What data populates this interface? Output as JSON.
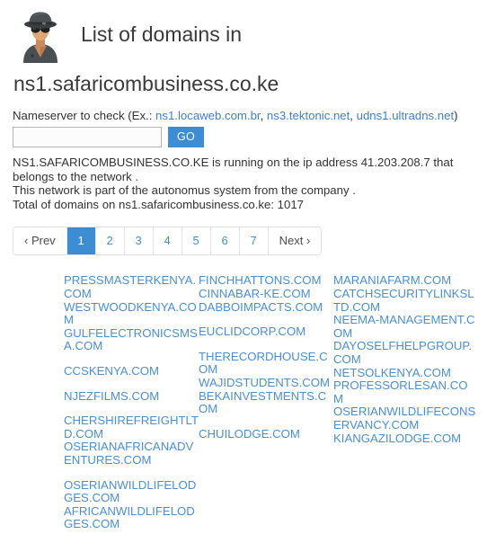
{
  "header": {
    "avatar_icon": "spy-detective-avatar-icon",
    "title_line1": "List of domains in",
    "title_line2": "ns1.safaricombusiness.co.ke"
  },
  "form": {
    "label_prefix": "Nameserver to check (Ex.: ",
    "examples": [
      "ns1.locaweb.com.br",
      "ns3.tektonic.net",
      "udns1.ultradns.net"
    ],
    "separator": ", ",
    "label_suffix": ")",
    "input_value": "",
    "input_placeholder": "",
    "submit_label": "GO"
  },
  "info": {
    "line1": "NS1.SAFARICOMBUSINESS.CO.KE is running on the ip address 41.203.208.7 that belongs to the network .",
    "line2": "This network is part of the autonomus system from the company .",
    "line3": "Total of domains on ns1.safaricombusiness.co.ke: 1017",
    "nameserver_upper": "NS1.SAFARICOMBUSINESS.CO.KE",
    "ip_address": "41.203.208.7",
    "nameserver": "ns1.safaricombusiness.co.ke",
    "total_domains": "1017"
  },
  "pagination": {
    "prev_label": "‹ Prev",
    "next_label": "Next ›",
    "pages": [
      "1",
      "2",
      "3",
      "4",
      "5",
      "6",
      "7"
    ],
    "active_page": "1"
  },
  "colors": {
    "accent": "#3d8dd4",
    "link": "#4a8fd4",
    "text": "#333333",
    "border": "#e0e0e0"
  },
  "domain_columns": [
    {
      "groups": [
        [
          "PRESSMASTERKENYA.COM",
          "WESTWOODKENYA.COM",
          "GULFELECTRONICSMSA.COM"
        ],
        [
          "CCSKENYA.COM"
        ],
        [
          "NJEZFILMS.COM"
        ],
        [
          "CHERSHIREFREIGHTLTD.COM",
          "OSERIANAFRICANADVENTURES.COM"
        ],
        [
          "OSERIANWILDLIFELODGES.COM",
          "AFRICANWILDLIFELODGES.COM"
        ]
      ]
    },
    {
      "groups": [
        [
          "FINCHHATTONS.COM",
          "CINNABAR-KE.COM",
          "DABBOIMPACTS.COM"
        ],
        [
          "EUCLIDCORP.COM"
        ],
        [
          "THERECORDHOUSE.COM",
          "WAJIDSTUDENTS.COM",
          "BEKAINVESTMENTS.COM"
        ],
        [
          "CHUILODGE.COM"
        ]
      ]
    },
    {
      "groups": [
        [
          "MARANIAFARM.COM",
          "CATCHSECURITYLINKSLTD.COM",
          "NEEMA-MANAGEMENT.COM",
          "DAYOSELFHELPGROUP.COM",
          "NETSOLKENYA.COM",
          "PROFESSORLESAN.COM",
          "OSERIANWILDLIFECONSERVANCY.COM",
          "KIANGAZILODGE.COM"
        ]
      ]
    }
  ]
}
